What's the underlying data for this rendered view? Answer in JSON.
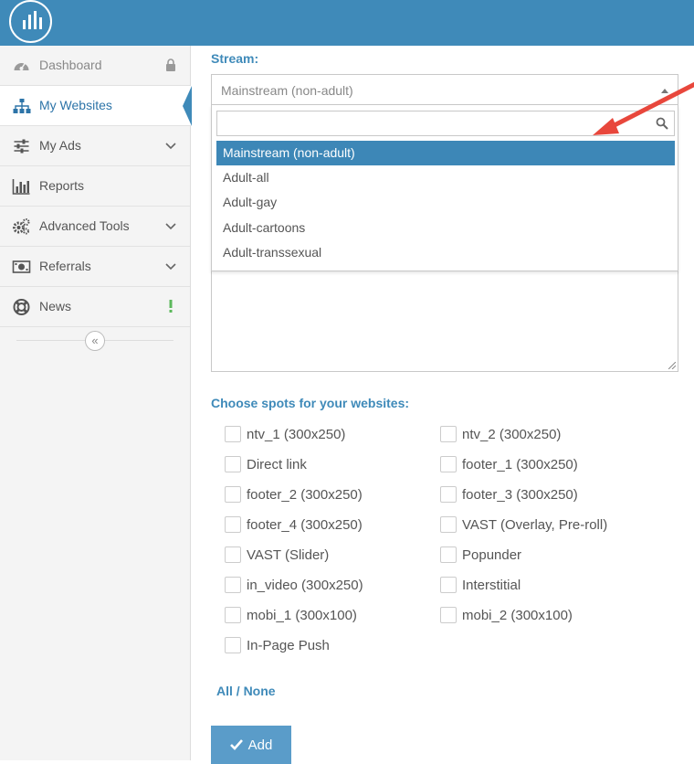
{
  "sidebar": {
    "items": [
      {
        "label": "Dashboard",
        "icon": "gauge-icon",
        "right": "lock-icon"
      },
      {
        "label": "My Websites",
        "icon": "sitemap-icon",
        "right": ""
      },
      {
        "label": "My Ads",
        "icon": "sliders-icon",
        "right": "chevron-down-icon"
      },
      {
        "label": "Reports",
        "icon": "bar-chart-icon",
        "right": ""
      },
      {
        "label": "Advanced Tools",
        "icon": "gears-icon",
        "right": "chevron-down-icon"
      },
      {
        "label": "Referrals",
        "icon": "money-icon",
        "right": "chevron-down-icon"
      },
      {
        "label": "News",
        "icon": "lifebuoy-icon",
        "right": "exclamation-icon"
      }
    ],
    "collapse_glyph": "«"
  },
  "form": {
    "stream_label": "Stream:",
    "stream_value": "Mainstream (non-adult)",
    "stream_options": [
      "Mainstream (non-adult)",
      "Adult-all",
      "Adult-gay",
      "Adult-cartoons",
      "Adult-transsexual"
    ],
    "search_value": "",
    "spots_label": "Choose spots for your websites:",
    "spots": [
      "ntv_1 (300x250)",
      "ntv_2 (300x250)",
      "Direct link",
      "footer_1 (300x250)",
      "footer_2 (300x250)",
      "footer_3 (300x250)",
      "footer_4 (300x250)",
      "VAST (Overlay, Pre-roll)",
      "VAST (Slider)",
      "Popunder",
      "in_video (300x250)",
      "Interstitial",
      "mobi_1 (300x100)",
      "mobi_2 (300x100)",
      "In-Page Push"
    ],
    "all_label": "All",
    "separator": "/",
    "none_label": "None",
    "add_label": "Add"
  },
  "colors": {
    "brand": "#3f8ab9",
    "highlight": "#3d87b7",
    "arrow": "#e8473c"
  }
}
